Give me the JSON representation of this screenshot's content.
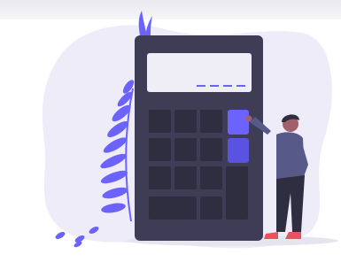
{
  "illustration": {
    "subject": "calculator",
    "keys_pressed": 2,
    "colors": {
      "accent": "#6c63ff",
      "backdrop": "#eeecf8",
      "calculator_body": "#3f3d56",
      "key": "#2f2e41",
      "screen": "#efeef6",
      "leaf": "#6c63ff",
      "person_shirt": "#575a89",
      "person_pants": "#2f2e41",
      "skin": "#a0616a",
      "hair": "#2f2e41",
      "shoes": "#e8525f"
    }
  }
}
